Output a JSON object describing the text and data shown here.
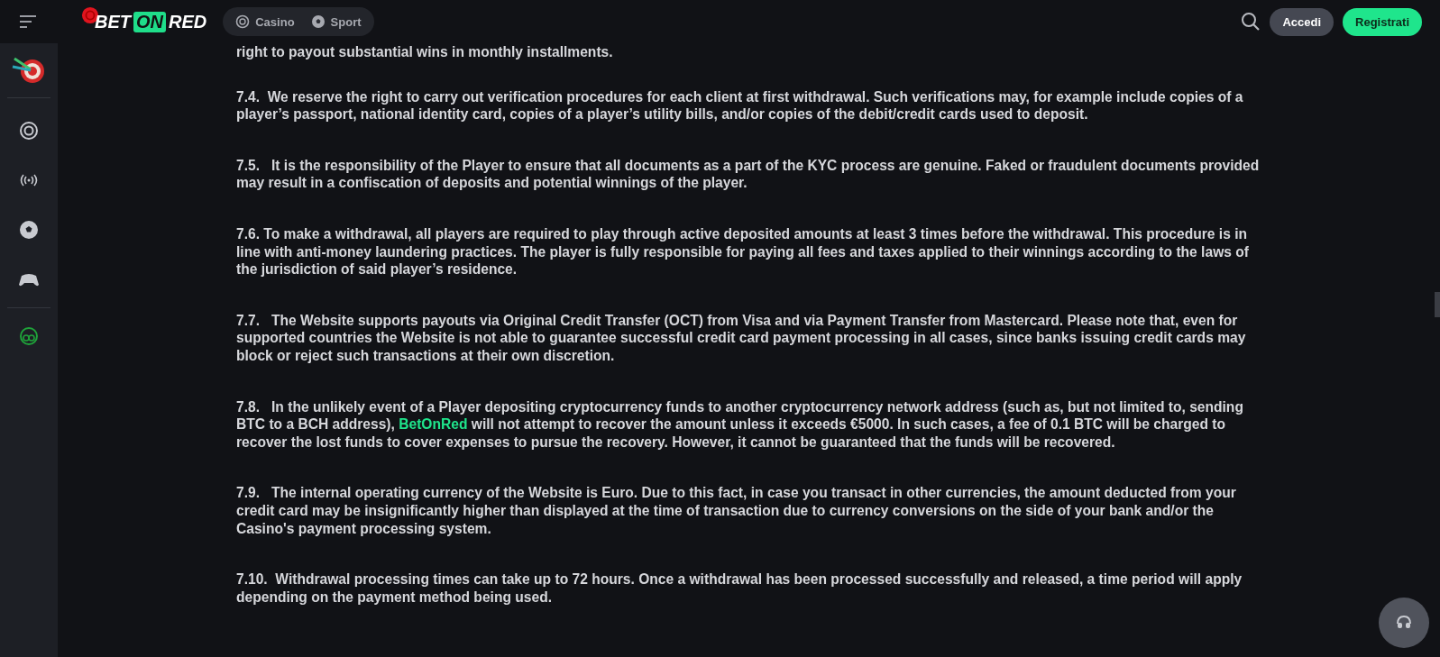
{
  "header": {
    "logo": [
      "BET",
      "ON",
      "RED"
    ],
    "nav": [
      {
        "label": "Casino",
        "selected": false
      },
      {
        "label": "Sport",
        "selected": false
      }
    ],
    "login": "Accedi",
    "register": "Registrati"
  },
  "paragraphs": [
    {
      "parts": [
        {
          "text": "right to payout substantial wins in monthly installments."
        }
      ]
    },
    {
      "parts": [
        {
          "text": "7.4.  We reserve the right to carry out verification procedures for each client at first withdrawal. Such verifications may, for example include copies of a player’s passport, national identity card, copies of a player’s utility bills, and/or copies of the debit/credit cards used to deposit."
        }
      ]
    },
    {
      "parts": [
        {
          "text": "7.5.   It is the responsibility of the Player to ensure that all documents as a part of the KYC process are genuine. Faked or fraudulent documents provided may result in a confiscation of deposits and potential winnings of the player."
        }
      ]
    },
    {
      "parts": [
        {
          "text": "7.6. To make a withdrawal, all players are required to play through active deposited amounts at least 3 times before the withdrawal. This procedure is in line with anti-money laundering practices. The player is fully responsible for paying all fees and taxes applied to their winnings according to the laws of the jurisdiction of said player’s residence."
        }
      ]
    },
    {
      "parts": [
        {
          "text": "7.7.   The Website supports payouts via Original Credit Transfer (OCT) from Visa and via Payment Transfer from Mastercard. Please note that, even for supported countries the Website is not able to guarantee successful credit card payment processing in all cases, since banks issuing credit cards may block or reject such transactions at their own discretion."
        }
      ]
    },
    {
      "parts": [
        {
          "text": "7.8.   In the unlikely event of a Player depositing cryptocurrency funds to another cryptocurrency network address (such as, but not limited to, sending BTC to a BCH address), "
        },
        {
          "text": "BetOnRed",
          "kind": "link"
        },
        {
          "text": " will not attempt to recover the amount unless it exceeds €5000. In such cases, a fee of 0.1 BTC will be charged to recover the lost funds to cover expenses to pursue the recovery. However, it cannot be guaranteed that the funds will be recovered."
        }
      ]
    },
    {
      "parts": [
        {
          "text": "7.9.   The internal operating currency of the Website is Euro. Due to this fact, in case you transact in other currencies, the amount deducted from your credit card may be insignificantly higher than displayed at the time of transaction due to currency conversions on the side of your bank and/or the Casino's payment processing system."
        }
      ]
    },
    {
      "parts": [
        {
          "text": "7.10.  Withdrawal processing times can take up to 72 hours. Once a withdrawal has been processed successfully and released, a time period will apply depending on the payment method being used."
        }
      ]
    }
  ]
}
